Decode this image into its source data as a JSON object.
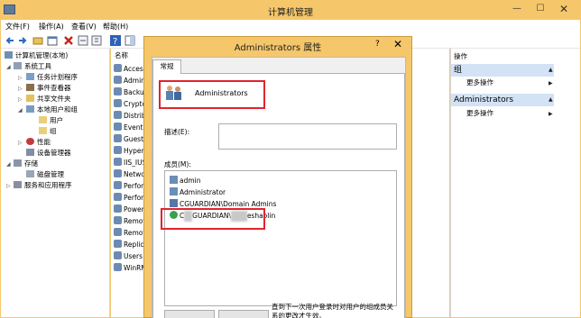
{
  "window": {
    "title": "计算机管理",
    "min": "—",
    "max": "☐",
    "close": "✕"
  },
  "menu": [
    "文件(F)",
    "操作(A)",
    "查看(V)",
    "帮助(H)"
  ],
  "tree": {
    "root": "计算机管理(本地)",
    "system_tools": "系统工具",
    "task_scheduler": "任务计划程序",
    "event_viewer": "事件查看器",
    "shared_folders": "共享文件夹",
    "local_users": "本地用户和组",
    "users": "用户",
    "groups": "组",
    "performance": "性能",
    "device_manager": "设备管理器",
    "storage": "存储",
    "disk_mgmt": "磁盘管理",
    "services": "服务和应用程序"
  },
  "list": {
    "header": "名称",
    "items": [
      "Access",
      "Admin",
      "Backu",
      "Crypto",
      "Distrib",
      "Event",
      "Guests",
      "Hyper",
      "IIS_IUS",
      "Netwo",
      "Perfor",
      "Perfor",
      "Power",
      "Remot",
      "Remot",
      "Replic",
      "Users",
      "WinRM"
    ]
  },
  "actions": {
    "header": "操作",
    "group1": "组",
    "more1": "更多操作",
    "group2": "Administrators",
    "more2": "更多操作"
  },
  "dialog": {
    "title": "Administrators 属性",
    "help": "?",
    "close": "✕",
    "tab": "常规",
    "group_name": "Administrators",
    "desc_label": "描述(E):",
    "members_label": "成员(M):",
    "members": {
      "m1": "admin",
      "m2": "Administrator",
      "m3": "CGUARDIAN\\Domain Admins",
      "m4_pre": "C",
      "m4_mid": "GUARDIAN\\",
      "m4_post": "eshaolin"
    },
    "note": "直到下一次用户登录时对用户的组成员关系的更改才生效。"
  }
}
